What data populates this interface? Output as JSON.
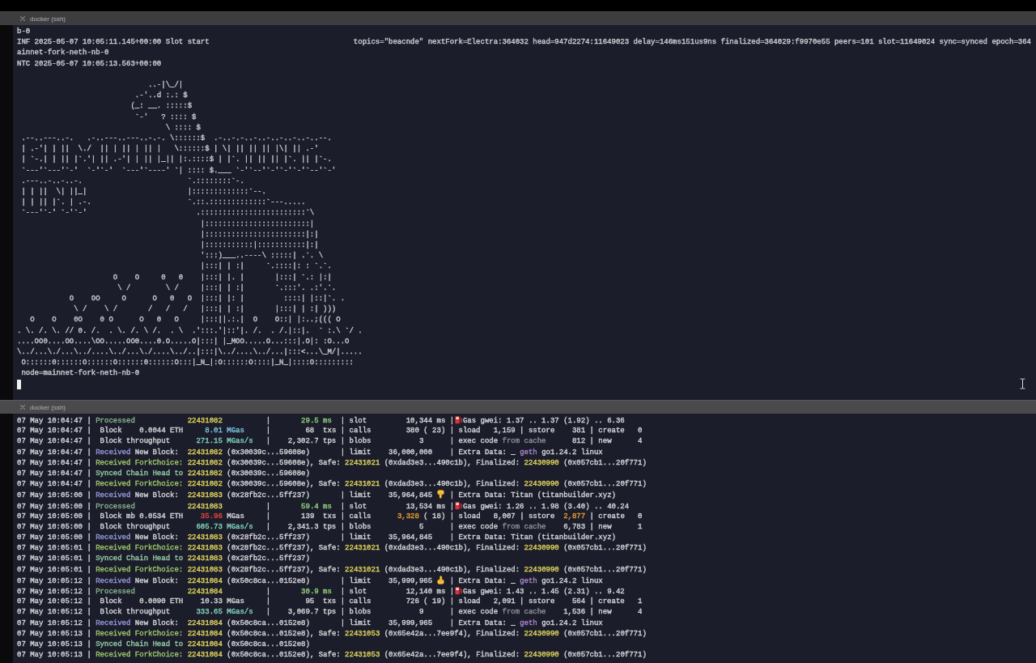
{
  "top_pane": {
    "tab_title": "docker (ssh)",
    "lines": [
      {
        "text": "b-0"
      },
      {
        "text": "INF 2025-05-07 10:05:11.145+00:00 Slot start",
        "fields": "topics=\"beacnde\" nextFork=Electra:364032 head=947d2274:11649023 delay=146ms151us9ns finalized=364029:f9970e55 peers=101 slot=11649024 sync=synced epoch=364"
      },
      {
        "text": "ainnet-fork-neth-nb-0"
      },
      {
        "text": "NTC 2025-05-07 10:05:13.563+00:00"
      }
    ],
    "banner": [
      "                              ..-|\\_/|",
      "                           .-'..d :.: $",
      "                          (_: __. :::::$",
      "                           `-'   ? :::: $",
      "                                  \\ :::: $",
      " .--..---..-.   .-..---..---..-.-. \\::::::$  .-..-.-..-..-..-..-..-..--.",
      " | .-'| | ||  \\./  || | || | || |   \\::::::$ | \\| || || || |\\| || .-'",
      " | `-.| | || |`.'| || .-'| | || |_|| |:.::::$ | |`. || || || |`. || |`-.",
      " `---'`---'`-'  `-'`-'  `---'`----' `| :::: $.___ `-'`--'`-'`-'`-'`--'`-'",
      " .---..-..-..-.                        `.::::::::`-.",
      " | | ||  \\| ||_|                       |:::::::::::::`--.",
      " | | || |`. | .-.                      `.::.:::::::::::::`---.....",
      " `---'`-' `-'`-'                         .::::::::::::::::::::::::`\\",
      "                                          |::::::::::::::::::::::::|",
      "                                          |:::::::::::::::::::::::|:|",
      "                                          |:::::::::::|:::::::::::|:|",
      "                                          ':::)___..----\\ :::::| .`. \\",
      "                                          |:::| | :|     `.::::|: : `.`.",
      "                      O    O     0   0    |:::| |. |       |:::| `.: |:|",
      "                       \\ /        \\ /     |:::| | :|       `.:::'. .:'.`.",
      "            O    OO     O      O   0   O  |:::| |: |         ::::| |::|`. .",
      "             \\ /    \\ /       /   /   /   |:::| | :|       |:::| | :| )))",
      "   O    O    0O    0 O      O   0   O     |:::||.:.|  O    O::| |:..;((( O",
      ". \\. /. \\. // 0. /.  . \\. /. \\ /.  . \\  .':::.'|::'|. /.  . /.|::|.  ` :.\\ `/ .",
      "....OO0....OO....\\OO.....OO0....0.O.....O|:::| |_MOO.....O...:::|.O|: :O...O",
      "\\../...\\./...\\../....\\../...\\./....\\../..|:::|\\../....\\../...|:::<...\\_M/|.....",
      " O::::::0::::::O::::::O::::::0::::::O:::|_N_|:O::::::O::::|_N_|::::O:::::::::"
    ],
    "after_banner": [
      {
        "text": "node=mainnet-fork-neth-nb-0"
      }
    ],
    "cursor": true
  },
  "bottom_pane": {
    "tab_title": "docker (ssh)",
    "lines": [
      {
        "kind": "processed",
        "segments": [
          {
            "text": "07 May 10:04:47 | "
          },
          {
            "text": "Processed",
            "color": "#84b08a"
          },
          {
            "text": "            22431082",
            "color": "#ddd25c"
          },
          {
            "text": "          |       "
          },
          {
            "text": "29.5 ms",
            "color": "#8fcf7a"
          },
          {
            "text": "  | slot         10,344 ms |"
          }
        ],
        "rest": [
          {
            "text": "Gas gwei: 1.37 .. 1.37 (1.92) .. 6.36"
          }
        ]
      },
      {
        "kind": "plain",
        "segments": [
          {
            "text": "07 May 10:04:47 |  Block    0.0044 ETH     "
          },
          {
            "text": "8.01 MGas",
            "color": "#7cc0dc"
          },
          {
            "text": "     |        68  txs | calls        380 ( 23) | sload   1,159 | sstore    381 | create   0"
          }
        ]
      },
      {
        "kind": "plain",
        "segments": [
          {
            "text": "07 May 10:04:47 |  Block throughput      "
          },
          {
            "text": "271.15 MGas/s",
            "color": "#7fcfb8"
          },
          {
            "text": "   |    2,302.7 tps | blobs           3      | exec code "
          },
          {
            "text": "from cache",
            "color": "#8a8c95"
          },
          {
            "text": "      812 | new      4"
          }
        ]
      },
      {
        "kind": "new-block",
        "segments": [
          {
            "text": "07 May 10:04:47 | "
          },
          {
            "text": "Received",
            "color": "#9297d6"
          },
          {
            "text": " New Block:  "
          },
          {
            "text": "22431082",
            "color": "#ddd25c"
          },
          {
            "text": " (0x30039c...59608e)       | limit    36,000,000    | Extra Data: _ "
          },
          {
            "text": "geth",
            "color": "#a884c8"
          },
          {
            "text": " go1.24.2 linux"
          }
        ]
      },
      {
        "kind": "plain",
        "segments": [
          {
            "text": "07 May 10:04:47 | "
          },
          {
            "text": "Received ForkChoice:",
            "color": "#9cc46a"
          },
          {
            "text": " 22431082",
            "color": "#ddd25c"
          },
          {
            "text": " (0x30039c...59608e), Safe: "
          },
          {
            "text": "22431021",
            "color": "#ddd25c"
          },
          {
            "text": " (0xdad3e3...490c1b), Finalized: "
          },
          {
            "text": "22430990",
            "color": "#ddd25c"
          },
          {
            "text": " (0x057cb1...20f771)"
          }
        ]
      },
      {
        "kind": "plain",
        "segments": [
          {
            "text": "07 May 10:04:47 | "
          },
          {
            "text": "Synced Chain Head to",
            "color": "#93c8a2"
          },
          {
            "text": " 22431082",
            "color": "#ddd25c"
          },
          {
            "text": " (0x30039c...59608e)"
          }
        ]
      },
      {
        "kind": "plain",
        "segments": [
          {
            "text": "07 May 10:04:47 | "
          },
          {
            "text": "Received ForkChoice:",
            "color": "#9cc46a"
          },
          {
            "text": " 22431082",
            "color": "#ddd25c"
          },
          {
            "text": " (0x30039c...59608e), Safe: "
          },
          {
            "text": "22431021",
            "color": "#ddd25c"
          },
          {
            "text": " (0xdad3e3...490c1b), Finalized: "
          },
          {
            "text": "22430990",
            "color": "#ddd25c"
          },
          {
            "text": " (0x057cb1...20f771)"
          }
        ]
      },
      {
        "kind": "new-block",
        "limit_lowered": true,
        "segments": [
          {
            "text": "07 May 10:05:00 | "
          },
          {
            "text": "Received",
            "color": "#9297d6"
          },
          {
            "text": " New Block:  "
          },
          {
            "text": "22431083",
            "color": "#ddd25c"
          },
          {
            "text": " (0x28fb2c...5ff237)       | limit    35,964,845 "
          }
        ],
        "rest": [
          {
            "text": " | Extra Data: Titan (titanbuilder.xyz)"
          }
        ]
      },
      {
        "kind": "processed",
        "segments": [
          {
            "text": "07 May 10:05:00 | "
          },
          {
            "text": "Processed",
            "color": "#84b08a"
          },
          {
            "text": "            22431083",
            "color": "#ddd25c"
          },
          {
            "text": "          |       "
          },
          {
            "text": "59.4 ms",
            "color": "#8fcf7a"
          },
          {
            "text": "  | slot         13,534 ms |"
          }
        ],
        "rest": [
          {
            "text": "Gas gwei: 1.26 .. 1.98 (3.40) .. 40.24"
          }
        ]
      },
      {
        "kind": "plain",
        "segments": [
          {
            "text": "07 May 10:05:00 |  Block mb 0.0534 ETH    "
          },
          {
            "text": "35.96",
            "color": "#e2453f"
          },
          {
            "text": " MGas     |       139  txs | calls      "
          },
          {
            "text": "3,328",
            "color": "#e59a32"
          },
          {
            "text": " ( 18) | sload   8,007 | sstore  "
          },
          {
            "text": "2,877",
            "color": "#e59a32"
          },
          {
            "text": " | create   0"
          }
        ]
      },
      {
        "kind": "plain",
        "segments": [
          {
            "text": "07 May 10:05:00 |  Block throughput      "
          },
          {
            "text": "605.73 MGas/s",
            "color": "#7fcfb8"
          },
          {
            "text": "   |    2,341.3 tps | blobs           5      | exec code "
          },
          {
            "text": "from cache",
            "color": "#8a8c95"
          },
          {
            "text": "    6,783 | new      1"
          }
        ]
      },
      {
        "kind": "new-block",
        "segments": [
          {
            "text": "07 May 10:05:00 | "
          },
          {
            "text": "Received",
            "color": "#9297d6"
          },
          {
            "text": " New Block:  "
          },
          {
            "text": "22431083",
            "color": "#ddd25c"
          },
          {
            "text": " (0x28fb2c...5ff237)       | limit    35,964,845    | Extra Data: Titan (titanbuilder.xyz)"
          }
        ]
      },
      {
        "kind": "plain",
        "segments": [
          {
            "text": "07 May 10:05:01 | "
          },
          {
            "text": "Received ForkChoice:",
            "color": "#9cc46a"
          },
          {
            "text": " 22431083",
            "color": "#ddd25c"
          },
          {
            "text": " (0x28fb2c...5ff237), Safe: "
          },
          {
            "text": "22431021",
            "color": "#ddd25c"
          },
          {
            "text": " (0xdad3e3...490c1b), Finalized: "
          },
          {
            "text": "22430990",
            "color": "#ddd25c"
          },
          {
            "text": " (0x057cb1...20f771)"
          }
        ]
      },
      {
        "kind": "plain",
        "segments": [
          {
            "text": "07 May 10:05:01 | "
          },
          {
            "text": "Synced Chain Head to",
            "color": "#93c8a2"
          },
          {
            "text": " 22431083",
            "color": "#ddd25c"
          },
          {
            "text": " (0x28fb2c...5ff237)"
          }
        ]
      },
      {
        "kind": "plain",
        "segments": [
          {
            "text": "07 May 10:05:01 | "
          },
          {
            "text": "Received ForkChoice:",
            "color": "#9cc46a"
          },
          {
            "text": " 22431083",
            "color": "#ddd25c"
          },
          {
            "text": " (0x28fb2c...5ff237), Safe: "
          },
          {
            "text": "22431021",
            "color": "#ddd25c"
          },
          {
            "text": " (0xdad3e3...490c1b), Finalized: "
          },
          {
            "text": "22430990",
            "color": "#ddd25c"
          },
          {
            "text": " (0x057cb1...20f771)"
          }
        ]
      },
      {
        "kind": "new-block",
        "limit_lowered": false,
        "segments": [
          {
            "text": "07 May 10:05:12 | "
          },
          {
            "text": "Received",
            "color": "#9297d6"
          },
          {
            "text": " New Block:  "
          },
          {
            "text": "22431084",
            "color": "#ddd25c"
          },
          {
            "text": " (0x50c8ca...0152e8)       | limit    35,999,965 "
          }
        ],
        "rest": [
          {
            "text": " | Extra Data: _ "
          },
          {
            "text": "geth",
            "color": "#a884c8"
          },
          {
            "text": " go1.24.2 linux"
          }
        ]
      },
      {
        "kind": "processed",
        "segments": [
          {
            "text": "07 May 10:05:12 | "
          },
          {
            "text": "Processed",
            "color": "#84b08a"
          },
          {
            "text": "            22431084",
            "color": "#ddd25c"
          },
          {
            "text": "          |       "
          },
          {
            "text": "30.9 ms",
            "color": "#8fcf7a"
          },
          {
            "text": "  | slot         12,140 ms |"
          }
        ],
        "rest": [
          {
            "text": "Gas gwei: 1.43 .. 1.45 (2.31) .. 9.42"
          }
        ]
      },
      {
        "kind": "plain",
        "segments": [
          {
            "text": "07 May 10:05:12 |  Block    0.0090 ETH    10.33 MGas     |        95  txs | calls        726 ( 19) | sload   2,091 | sstore    564 | create   1"
          }
        ]
      },
      {
        "kind": "plain",
        "segments": [
          {
            "text": "07 May 10:05:12 |  Block throughput      "
          },
          {
            "text": "333.65 MGas/s",
            "color": "#7fcfb8"
          },
          {
            "text": "   |    3,069.7 tps | blobs           9      | exec code "
          },
          {
            "text": "from cache",
            "color": "#8a8c95"
          },
          {
            "text": "    1,536 | new      4"
          }
        ]
      },
      {
        "kind": "new-block",
        "segments": [
          {
            "text": "07 May 10:05:12 | "
          },
          {
            "text": "Received",
            "color": "#9297d6"
          },
          {
            "text": " New Block:  "
          },
          {
            "text": "22431084",
            "color": "#ddd25c"
          },
          {
            "text": " (0x50c8ca...0152e8)       | limit    35,999,965    | Extra Data: _ "
          },
          {
            "text": "geth",
            "color": "#a884c8"
          },
          {
            "text": " go1.24.2 linux"
          }
        ]
      },
      {
        "kind": "plain",
        "segments": [
          {
            "text": "07 May 10:05:13 | "
          },
          {
            "text": "Received ForkChoice:",
            "color": "#9cc46a"
          },
          {
            "text": " 22431084",
            "color": "#ddd25c"
          },
          {
            "text": " (0x50c8ca...0152e8), Safe: "
          },
          {
            "text": "22431053",
            "color": "#ddd25c"
          },
          {
            "text": " (0x65e42a...7ee9f4), Finalized: "
          },
          {
            "text": "22430990",
            "color": "#ddd25c"
          },
          {
            "text": " (0x057cb1...20f771)"
          }
        ]
      },
      {
        "kind": "plain",
        "segments": [
          {
            "text": "07 May 10:05:13 | "
          },
          {
            "text": "Synced Chain Head to",
            "color": "#93c8a2"
          },
          {
            "text": " 22431084",
            "color": "#ddd25c"
          },
          {
            "text": " (0x50c8ca...0152e8)"
          }
        ]
      },
      {
        "kind": "plain",
        "segments": [
          {
            "text": "07 May 10:05:13 | "
          },
          {
            "text": "Received ForkChoice:",
            "color": "#9cc46a"
          },
          {
            "text": " 22431084",
            "color": "#ddd25c"
          },
          {
            "text": " (0x50c8ca...0152e8), Safe: "
          },
          {
            "text": "22431053",
            "color": "#ddd25c"
          },
          {
            "text": " (0x65e42a...7ee9f4), Finalized: "
          },
          {
            "text": "22430990",
            "color": "#ddd25c"
          },
          {
            "text": " (0x057cb1...20f771)"
          }
        ]
      }
    ]
  }
}
